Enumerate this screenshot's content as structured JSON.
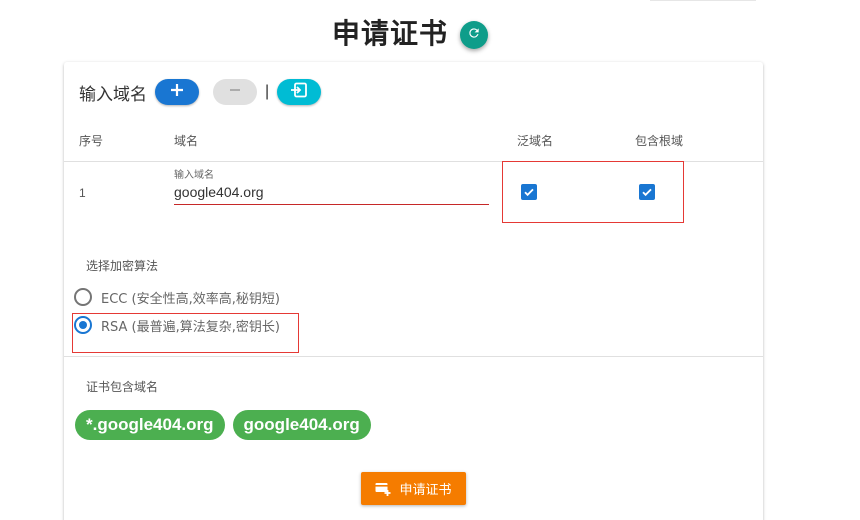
{
  "page": {
    "title": "申请证书"
  },
  "domain_section": {
    "label": "输入域名",
    "add_icon": "plus-icon",
    "remove_icon": "minus-icon",
    "separator": "|",
    "import_icon": "import-icon"
  },
  "table": {
    "headers": {
      "index": "序号",
      "domain": "域名",
      "wildcard": "泛域名",
      "include_root": "包含根域"
    },
    "rows": [
      {
        "index": "1",
        "field_caption": "输入域名",
        "domain": "google404.org",
        "wildcard": true,
        "include_root": true
      }
    ]
  },
  "algorithm": {
    "label": "选择加密算法",
    "options": [
      {
        "label": "ECC (安全性高,效率高,秘钥短)",
        "selected": false
      },
      {
        "label": "RSA (最普遍,算法复杂,密钥长)",
        "selected": true
      }
    ]
  },
  "cert_domains": {
    "label": "证书包含域名",
    "chips": [
      "*.google404.org",
      "google404.org"
    ]
  },
  "apply_button": {
    "label": "申请证书",
    "icon": "certificate-add-icon"
  },
  "colors": {
    "primary": "#1976d2",
    "teal": "#0f9d8a",
    "cyan": "#00bcd4",
    "green": "#4caf50",
    "orange": "#f57c00",
    "highlight_red": "#e53935"
  }
}
